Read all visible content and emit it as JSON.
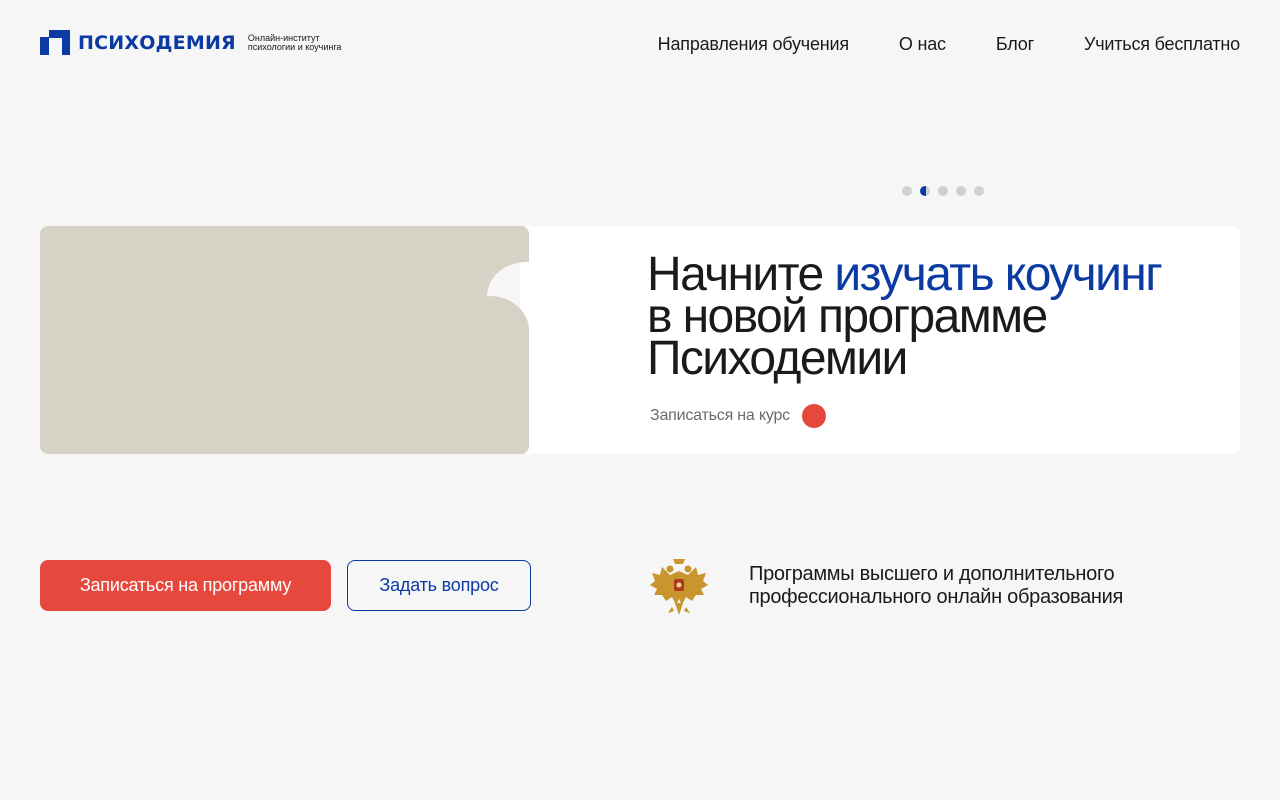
{
  "header": {
    "logo": {
      "name": "ПСИХОДЕМИЯ",
      "tagline_line1": "Онлайн-институт",
      "tagline_line2": "психологии и коучинга",
      "brand_color": "#0b3aa3"
    },
    "nav": [
      {
        "label": "Направления обучения"
      },
      {
        "label": "О нас"
      },
      {
        "label": "Блог"
      },
      {
        "label": "Учиться бесплатно"
      }
    ]
  },
  "slider": {
    "slide_count": 5,
    "active_index": 1,
    "headline_part1": "Начните ",
    "headline_accent": "изучать коучинг",
    "headline_part2": "в новой программе Психодемии",
    "cta_label": "Записаться на курс",
    "image_color": "#d7d2c6",
    "cta_dot_color": "#e6483d"
  },
  "actions": {
    "primary_label": "Записаться на программу",
    "secondary_label": "Задать вопрос"
  },
  "accreditation": {
    "icon": "coat-of-arms-icon",
    "line1": "Программы высшего и дополнительного",
    "line2": "профессионального онлайн образования"
  },
  "colors": {
    "background": "#f6f6f6",
    "accent_blue": "#0b3aa3",
    "accent_red": "#e6483d",
    "emblem_gold": "#c8962c"
  }
}
